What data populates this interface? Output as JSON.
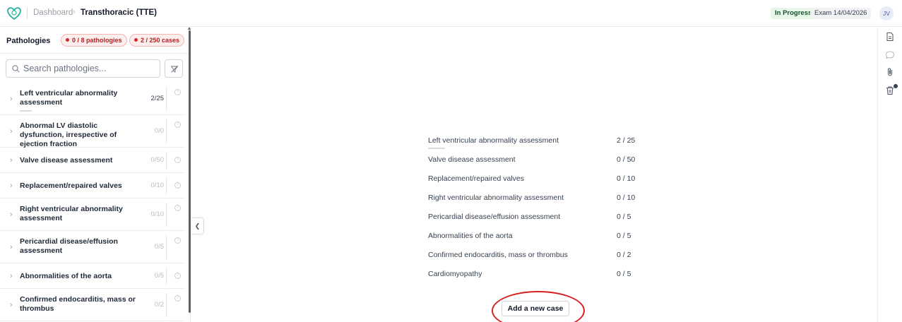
{
  "header": {
    "breadcrumb_home": "Dashboard",
    "breadcrumb_separator": "›",
    "breadcrumb_current": "Transthoracic (TTE)",
    "status": "In Progress",
    "exam_date": "Exam 14/04/2026",
    "avatar_initials": "JV"
  },
  "sidebar": {
    "title": "Pathologies",
    "pathologies_badge": "0 / 8 pathologies",
    "cases_badge": "2 / 250 cases",
    "search_placeholder": "Search pathologies...",
    "items": [
      {
        "label": "Left ventricular abnormality assessment",
        "count": "2/25",
        "progress": 0.08
      },
      {
        "label": "Abnormal LV diastolic dysfunction, irrespective of ejection fraction",
        "count": "0/0"
      },
      {
        "label": "Valve disease assessment",
        "count": "0/50"
      },
      {
        "label": "Replacement/repaired valves",
        "count": "0/10"
      },
      {
        "label": "Right ventricular abnormality assessment",
        "count": "0/10"
      },
      {
        "label": "Pericardial disease/effusion assessment",
        "count": "0/5"
      },
      {
        "label": "Abnormalities of the aorta",
        "count": "0/5"
      },
      {
        "label": "Confirmed endocarditis, mass or thrombus",
        "count": "0/2"
      }
    ]
  },
  "summary": {
    "rows": [
      {
        "label": "Left ventricular abnormality assessment",
        "value": "2 / 25",
        "progress": 0.08
      },
      {
        "label": "Valve disease assessment",
        "value": "0 / 50"
      },
      {
        "label": "Replacement/repaired valves",
        "value": "0 / 10"
      },
      {
        "label": "Right ventricular abnormality assessment",
        "value": "0 / 10"
      },
      {
        "label": "Pericardial disease/effusion assessment",
        "value": "0 / 5"
      },
      {
        "label": "Abnormalities of the aorta",
        "value": "0 / 5"
      },
      {
        "label": "Confirmed endocarditis, mass or thrombus",
        "value": "0 / 2"
      },
      {
        "label": "Cardiomyopathy",
        "value": "0 / 5"
      }
    ],
    "add_button_label": "Add a new case"
  },
  "colors": {
    "status_bg": "#e7f6e9",
    "badge_red": "#dc2626",
    "highlight": "#d61f1f"
  },
  "icons": {
    "logo": "heart-shield-logo",
    "search": "search-icon",
    "filter": "filter-icon",
    "rail": [
      "document-icon",
      "comment-icon",
      "paperclip-icon",
      "trash-icon"
    ]
  }
}
